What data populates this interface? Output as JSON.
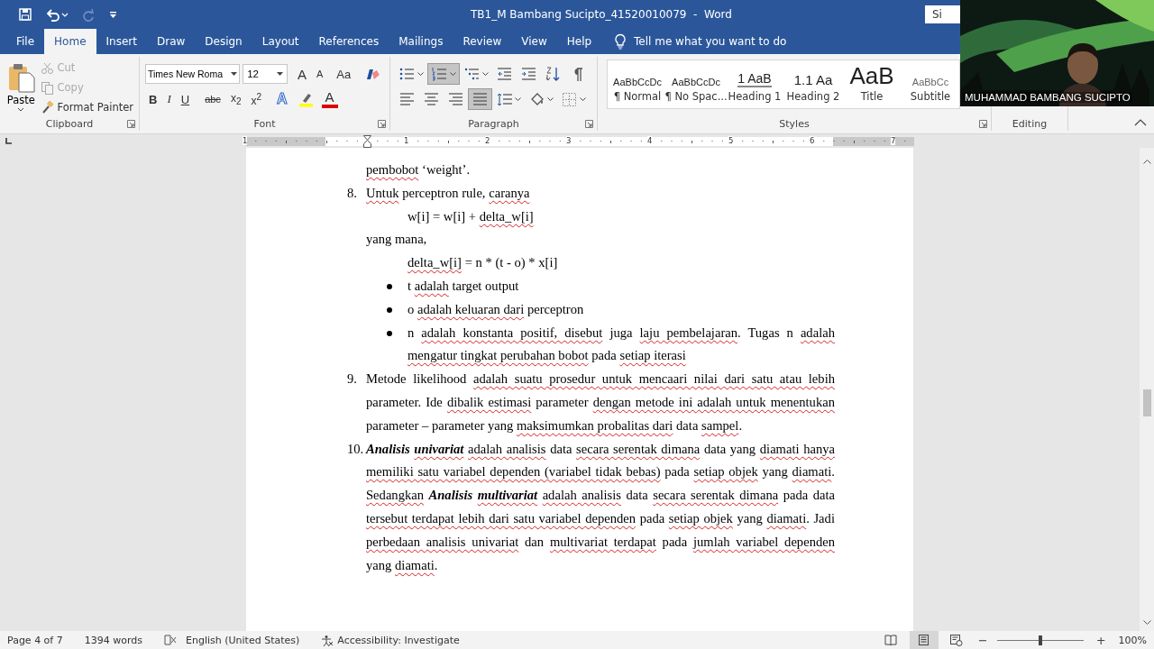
{
  "window": {
    "title": "TB1_M Bambang Sucipto_41520010079  -  Word",
    "sign_in": "Si"
  },
  "quick_access": [
    {
      "kind": "save"
    },
    {
      "kind": "undo"
    },
    {
      "kind": "redo",
      "disabled": true
    },
    {
      "kind": "customize"
    }
  ],
  "tabs": [
    {
      "label": "File",
      "selected": false
    },
    {
      "label": "Home",
      "selected": true
    },
    {
      "label": "Insert",
      "selected": false
    },
    {
      "label": "Draw",
      "selected": false
    },
    {
      "label": "Design",
      "selected": false
    },
    {
      "label": "Layout",
      "selected": false
    },
    {
      "label": "References",
      "selected": false
    },
    {
      "label": "Mailings",
      "selected": false
    },
    {
      "label": "Review",
      "selected": false
    },
    {
      "label": "View",
      "selected": false
    },
    {
      "label": "Help",
      "selected": false
    }
  ],
  "tell_me": {
    "placeholder": "Tell me what you want to do"
  },
  "clipboard": {
    "label": "Clipboard",
    "paste": "Paste",
    "items": [
      {
        "kind": "cut",
        "label": "Cut",
        "disabled": true
      },
      {
        "kind": "copy",
        "label": "Copy",
        "disabled": true
      },
      {
        "kind": "painter",
        "label": "Format Painter",
        "disabled": false
      }
    ]
  },
  "font": {
    "label": "Font",
    "name": "Times New Roma",
    "size": "12",
    "row1": [
      {
        "kind": "grow",
        "label": "A"
      },
      {
        "kind": "shrink",
        "label": "A"
      },
      {
        "kind": "case",
        "label": "Aa"
      },
      {
        "kind": "clear"
      }
    ],
    "row2": [
      {
        "kind": "bold",
        "label": "B"
      },
      {
        "kind": "italic",
        "label": "I"
      },
      {
        "kind": "underline",
        "label": "U"
      },
      {
        "kind": "strike",
        "label": "abc"
      },
      {
        "kind": "sub",
        "label": "x$_{2}$"
      },
      {
        "kind": "sup",
        "label": "x$^{2}$"
      },
      {
        "kind": "effects",
        "label": "A"
      },
      {
        "kind": "highlight"
      },
      {
        "kind": "color",
        "label": "A"
      }
    ]
  },
  "paragraph": {
    "label": "Paragraph",
    "row1": [
      {
        "kind": "bullets",
        "selected": false
      },
      {
        "kind": "numbering",
        "selected": true
      },
      {
        "kind": "multilevel",
        "selected": false
      },
      {
        "kind": "outdent",
        "selected": false
      },
      {
        "kind": "indent",
        "selected": false
      },
      {
        "kind": "sort",
        "selected": false
      },
      {
        "kind": "marks",
        "selected": false
      }
    ],
    "row2": [
      {
        "kind": "left",
        "selected": false
      },
      {
        "kind": "center",
        "selected": false
      },
      {
        "kind": "right",
        "selected": false
      },
      {
        "kind": "justify",
        "selected": true
      },
      {
        "kind": "spacing",
        "selected": false
      },
      {
        "kind": "shading",
        "selected": false
      },
      {
        "kind": "borders",
        "selected": false
      }
    ]
  },
  "styles": {
    "label": "Styles",
    "items": [
      {
        "preview": "AaBbCcDc",
        "name": "¶ Normal",
        "kind": "normal"
      },
      {
        "preview": "AaBbCcDc",
        "name": "¶ No Spac...",
        "kind": "normal"
      },
      {
        "preview": "1  AaB",
        "name": "Heading 1",
        "kind": "heading1"
      },
      {
        "preview": "1.1  Aa",
        "name": "Heading 2",
        "kind": "heading2"
      },
      {
        "preview": "AaB",
        "name": "Title",
        "kind": "title"
      },
      {
        "preview": "AaBbCc",
        "name": "Subtitle",
        "kind": "subtitle"
      }
    ]
  },
  "editing": {
    "label": "Editing"
  },
  "ruler": {
    "marks": [
      "1",
      "1",
      "2",
      "3",
      "4",
      "5",
      "6",
      "7"
    ]
  },
  "document": {
    "paragraphs": [
      {
        "kind": "body",
        "runs": [
          {
            "text": "pembobot",
            "misspelled": true
          },
          {
            "text": " ‘weight’."
          }
        ]
      },
      {
        "kind": "numbered",
        "number": "8.",
        "runs": [
          {
            "text": "Untuk",
            "misspelled": true
          },
          {
            "text": " perceptron rule, "
          },
          {
            "text": "caranya",
            "misspelled": true
          }
        ]
      },
      {
        "kind": "formula",
        "runs": [
          {
            "text": "w[i] = w[i] + "
          },
          {
            "text": "delta_w[i]",
            "misspelled": true
          }
        ]
      },
      {
        "kind": "body",
        "runs": [
          {
            "text": "yang mana,"
          }
        ]
      },
      {
        "kind": "formula",
        "runs": [
          {
            "text": "delta_w[i]",
            "misspelled": true
          },
          {
            "text": " = n * (t - o) * x[i]"
          }
        ]
      },
      {
        "kind": "bullet",
        "runs": [
          {
            "text": "t "
          },
          {
            "text": "adalah",
            "misspelled": true
          },
          {
            "text": " target output"
          }
        ]
      },
      {
        "kind": "bullet",
        "runs": [
          {
            "text": "o "
          },
          {
            "text": "adalah keluaran dari",
            "misspelled": true
          },
          {
            "text": " perceptron"
          }
        ]
      },
      {
        "kind": "bullet",
        "runs": [
          {
            "text": "n "
          },
          {
            "text": "adalah konstanta positif, disebut",
            "misspelled": true
          },
          {
            "text": " juga "
          },
          {
            "text": "laju pembelajaran",
            "misspelled": true
          },
          {
            "text": ". Tugas n "
          },
          {
            "text": "adalah mengatur tingkat perubahan bobot",
            "misspelled": true
          },
          {
            "text": " pada "
          },
          {
            "text": "setiap iterasi",
            "misspelled": true
          }
        ]
      },
      {
        "kind": "numbered",
        "number": "9.",
        "runs": [
          {
            "text": "Metode likelihood "
          },
          {
            "text": "adalah suatu prosedur untuk mencaari nilai dari satu atau lebih",
            "misspelled": true
          },
          {
            "text": " parameter. Ide "
          },
          {
            "text": "dibalik estimasi",
            "misspelled": true
          },
          {
            "text": " parameter "
          },
          {
            "text": "dengan metode ini adalah untuk menentukan",
            "misspelled": true
          },
          {
            "text": " parameter – parameter yang "
          },
          {
            "text": "maksimumkan probalitas dari",
            "misspelled": true
          },
          {
            "text": " data "
          },
          {
            "text": "sampel",
            "misspelled": true
          },
          {
            "text": "."
          }
        ]
      },
      {
        "kind": "numbered",
        "number": "10.",
        "runs": [
          {
            "text": "Analisis ",
            "bold": true,
            "italic": true
          },
          {
            "text": "univariat",
            "bold": true,
            "italic": true,
            "misspelled": true
          },
          {
            "text": " adalah analisis",
            "misspelled": true
          },
          {
            "text": " data "
          },
          {
            "text": "secara serentak dimana",
            "misspelled": true
          },
          {
            "text": " data yang "
          },
          {
            "text": "diamati hanya memiliki satu variabel dependen (variabel tidak bebas)",
            "misspelled": true
          },
          {
            "text": " pada "
          },
          {
            "text": "setiap objek",
            "misspelled": true
          },
          {
            "text": " yang "
          },
          {
            "text": "diamati",
            "misspelled": true
          },
          {
            "text": ". "
          },
          {
            "text": "Sedangkan ",
            "misspelled": true
          },
          {
            "text": "Analisis ",
            "bold": true,
            "italic": true
          },
          {
            "text": "multivariat",
            "bold": true,
            "italic": true,
            "misspelled": true
          },
          {
            "text": " adalah analisis",
            "misspelled": true
          },
          {
            "text": " data "
          },
          {
            "text": "secara serentak dimana",
            "misspelled": true
          },
          {
            "text": " pada data "
          },
          {
            "text": "tersebut terdapat lebih dari satu variabel dependen",
            "misspelled": true
          },
          {
            "text": " pada "
          },
          {
            "text": "setiap objek",
            "misspelled": true
          },
          {
            "text": " yang "
          },
          {
            "text": "diamati",
            "misspelled": true
          },
          {
            "text": ". Jadi "
          },
          {
            "text": "perbedaan analisis univariat",
            "misspelled": true
          },
          {
            "text": " dan "
          },
          {
            "text": "multivariat terdapat",
            "misspelled": true
          },
          {
            "text": " pada "
          },
          {
            "text": "jumlah variabel dependen",
            "misspelled": true
          },
          {
            "text": " yang "
          },
          {
            "text": "diamati",
            "misspelled": true
          },
          {
            "text": "."
          }
        ]
      }
    ]
  },
  "video": {
    "kind": "picture",
    "name": "MUHAMMAD BAMBANG SUCIPTO"
  },
  "status_bar": {
    "page": "Page 4 of 7",
    "words": "1394 words",
    "language": "English (United States)",
    "accessibility": "Accessibility: Investigate",
    "views": [
      {
        "kind": "read",
        "selected": false
      },
      {
        "kind": "print",
        "selected": true
      },
      {
        "kind": "web",
        "selected": false
      }
    ],
    "zoom_out": "−",
    "zoom_in": "+",
    "zoom": {
      "level": 0.5
    },
    "zoom_label": "100%"
  }
}
